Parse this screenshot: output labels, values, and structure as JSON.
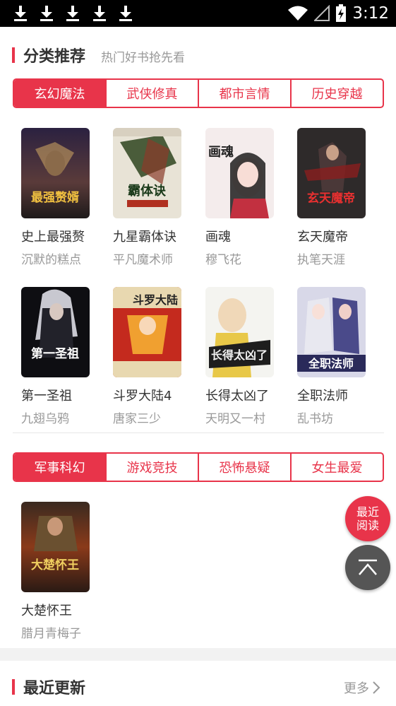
{
  "status_bar": {
    "time": "3:12",
    "download_icons": [
      "download-icon",
      "download-icon",
      "download-icon",
      "download-icon",
      "download-icon"
    ]
  },
  "category_section": {
    "title": "分类推荐",
    "subtitle": "热门好书抢先看",
    "tabs_row1": [
      "玄幻魔法",
      "武侠修真",
      "都市言情",
      "历史穿越"
    ],
    "tabs_row2": [
      "军事科幻",
      "游戏竞技",
      "恐怖悬疑",
      "女生最爱"
    ],
    "books_group1": [
      {
        "name": "史上最强赘",
        "author": "沉默的糕点",
        "cover_text": "最强赘婿"
      },
      {
        "name": "九星霸体诀",
        "author": "平凡魔术师",
        "cover_text": "霸体诀"
      },
      {
        "name": "画魂",
        "author": "穆飞花",
        "cover_text": "画魂"
      },
      {
        "name": "玄天魔帝",
        "author": "执笔天涯",
        "cover_text": "玄天魔帝"
      },
      {
        "name": "第一圣祖",
        "author": "九翅乌鸦",
        "cover_text": "第一圣祖"
      },
      {
        "name": "斗罗大陆4",
        "author": "唐家三少",
        "cover_text": "斗罗大陆"
      },
      {
        "name": "长得太凶了",
        "author": "天明又一村",
        "cover_text": "长得太凶了"
      },
      {
        "name": "全职法师",
        "author": "乱书坊",
        "cover_text": "全职法师"
      }
    ],
    "books_group2": [
      {
        "name": "大楚怀王",
        "author": "腊月青梅子",
        "cover_text": "大楚怀王"
      }
    ]
  },
  "fab": {
    "recent_line1": "最近",
    "recent_line2": "阅读"
  },
  "recent_section": {
    "title": "最近更新",
    "more_label": "更多"
  },
  "colors": {
    "accent": "#e8344a",
    "text": "#333333",
    "muted": "#999999"
  }
}
